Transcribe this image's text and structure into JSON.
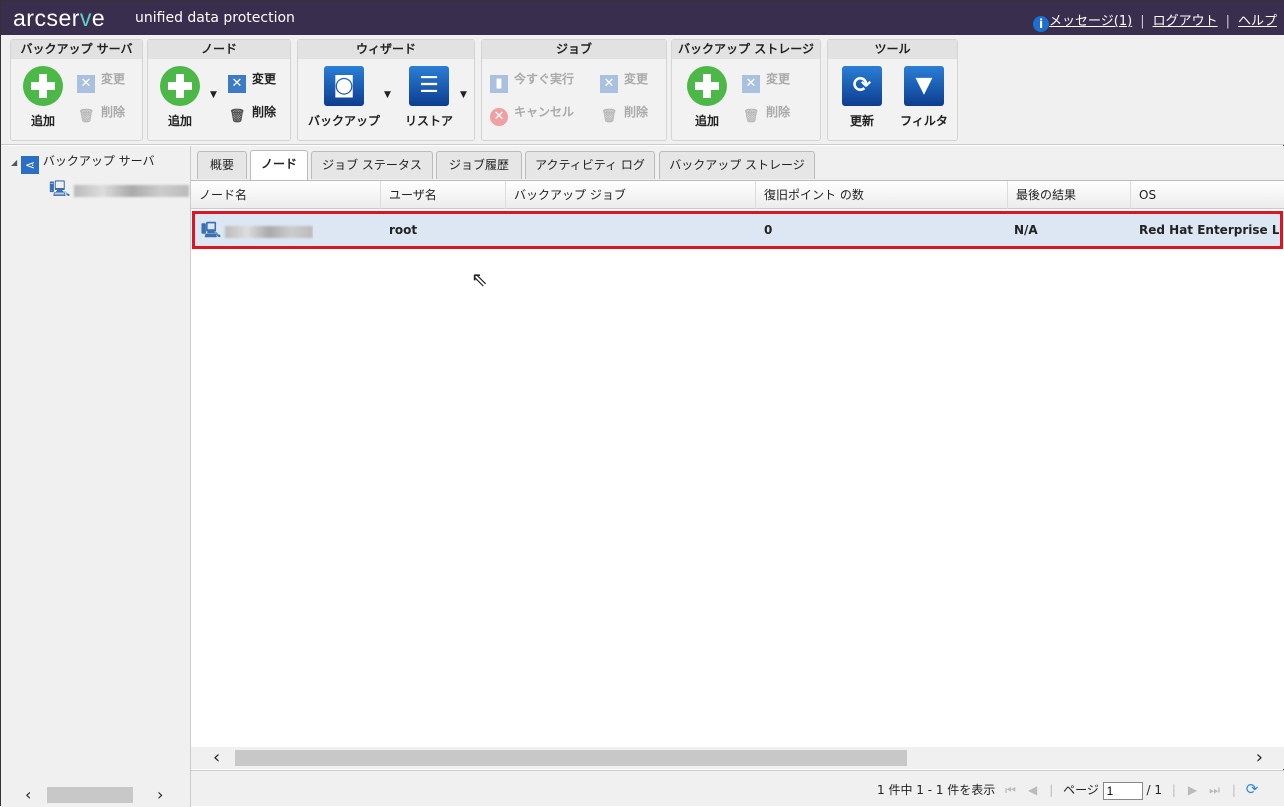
{
  "header": {
    "logo": "arcserve",
    "subtitle": "unified data protection",
    "messages": "メッセージ(1)",
    "logout": "ログアウト",
    "help": "ヘルプ",
    "sep": "|"
  },
  "toolbar": {
    "backup_server": {
      "title": "バックアップ サーバ",
      "add": "追加",
      "edit": "変更",
      "delete": "削除"
    },
    "node": {
      "title": "ノード",
      "add": "追加",
      "edit": "変更",
      "delete": "削除"
    },
    "wizard": {
      "title": "ウィザード",
      "backup": "バックアップ",
      "restore": "リストア"
    },
    "job": {
      "title": "ジョブ",
      "run_now": "今すぐ実行",
      "edit": "変更",
      "cancel": "キャンセル",
      "delete": "削除"
    },
    "storage": {
      "title": "バックアップ ストレージ",
      "add": "追加",
      "edit": "変更",
      "delete": "削除"
    },
    "tools": {
      "title": "ツール",
      "refresh": "更新",
      "filter": "フィルタ"
    }
  },
  "tree": {
    "root": "バックアップ サーバ"
  },
  "tabs": [
    "概要",
    "ノード",
    "ジョブ ステータス",
    "ジョブ履歴",
    "アクティビティ ログ",
    "バックアップ ストレージ"
  ],
  "grid": {
    "columns": [
      "ノード名",
      "ユーザ名",
      "バックアップ ジョブ",
      "復旧ポイント の数",
      "最後の結果",
      "OS"
    ],
    "rows": [
      {
        "user": "root",
        "job": "",
        "points": "0",
        "result": "N/A",
        "os": "Red Hat Enterprise Linux"
      }
    ]
  },
  "footer": {
    "summary": "1 件中 1 - 1 件を表示",
    "page_label": "ページ",
    "page": "1",
    "total": "/ 1"
  }
}
